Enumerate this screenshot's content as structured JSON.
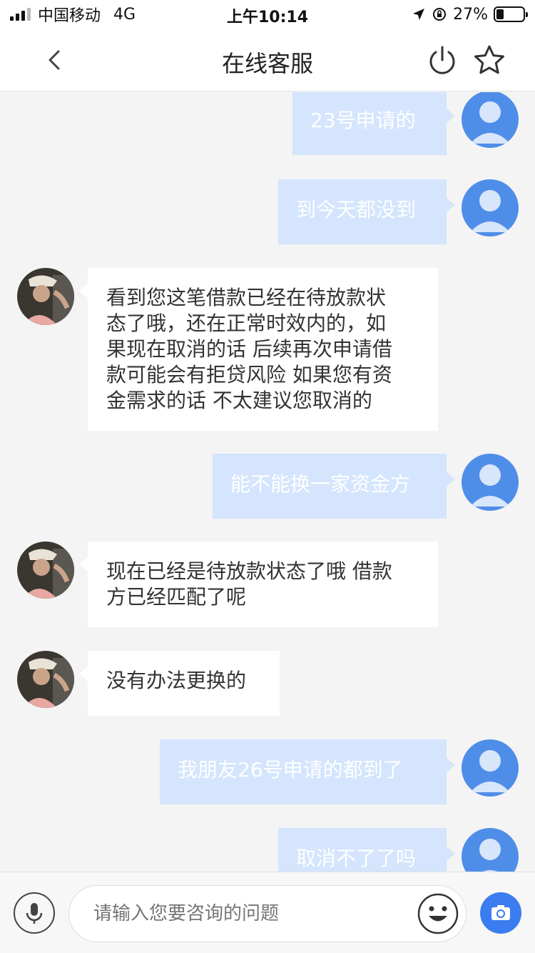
{
  "status_bar": {
    "carrier": "中国移动",
    "network": "4G",
    "time": "上午10:14",
    "battery_text": "27%",
    "battery_level": 0.27
  },
  "nav": {
    "title": "在线客服",
    "back_icon": "chevron-left-icon",
    "power_icon": "power-icon",
    "star_icon": "star-icon"
  },
  "messages": [
    {
      "from": "user",
      "lines": [
        "23号申请的"
      ]
    },
    {
      "from": "user",
      "lines": [
        "到今天都没到"
      ]
    },
    {
      "from": "agent",
      "lines": [
        "看到您这笔借款已经在待放款状",
        "态了哦，还在正常时效内的，如",
        "果现在取消的话 后续再次申请借",
        "款可能会有拒贷风险 如果您有资",
        "金需求的话 不太建议您取消的"
      ]
    },
    {
      "from": "user",
      "lines": [
        "能不能换一家资金方"
      ]
    },
    {
      "from": "agent",
      "lines": [
        "现在已经是待放款状态了哦 借款",
        "方已经匹配了呢"
      ]
    },
    {
      "from": "agent",
      "lines": [
        "没有办法更换的"
      ]
    },
    {
      "from": "user",
      "lines": [
        "我朋友26号申请的都到了"
      ]
    },
    {
      "from": "user",
      "lines": [
        "取消不了了吗"
      ]
    }
  ],
  "input_bar": {
    "placeholder": "请输入您要咨询的问题",
    "mic_icon": "microphone-icon",
    "emoji_icon": "emoji-icon",
    "camera_icon": "camera-icon"
  },
  "colors": {
    "user_bubble": "#d4e5fd",
    "user_avatar": "#4f8ee8",
    "accent": "#3b7cf0"
  }
}
